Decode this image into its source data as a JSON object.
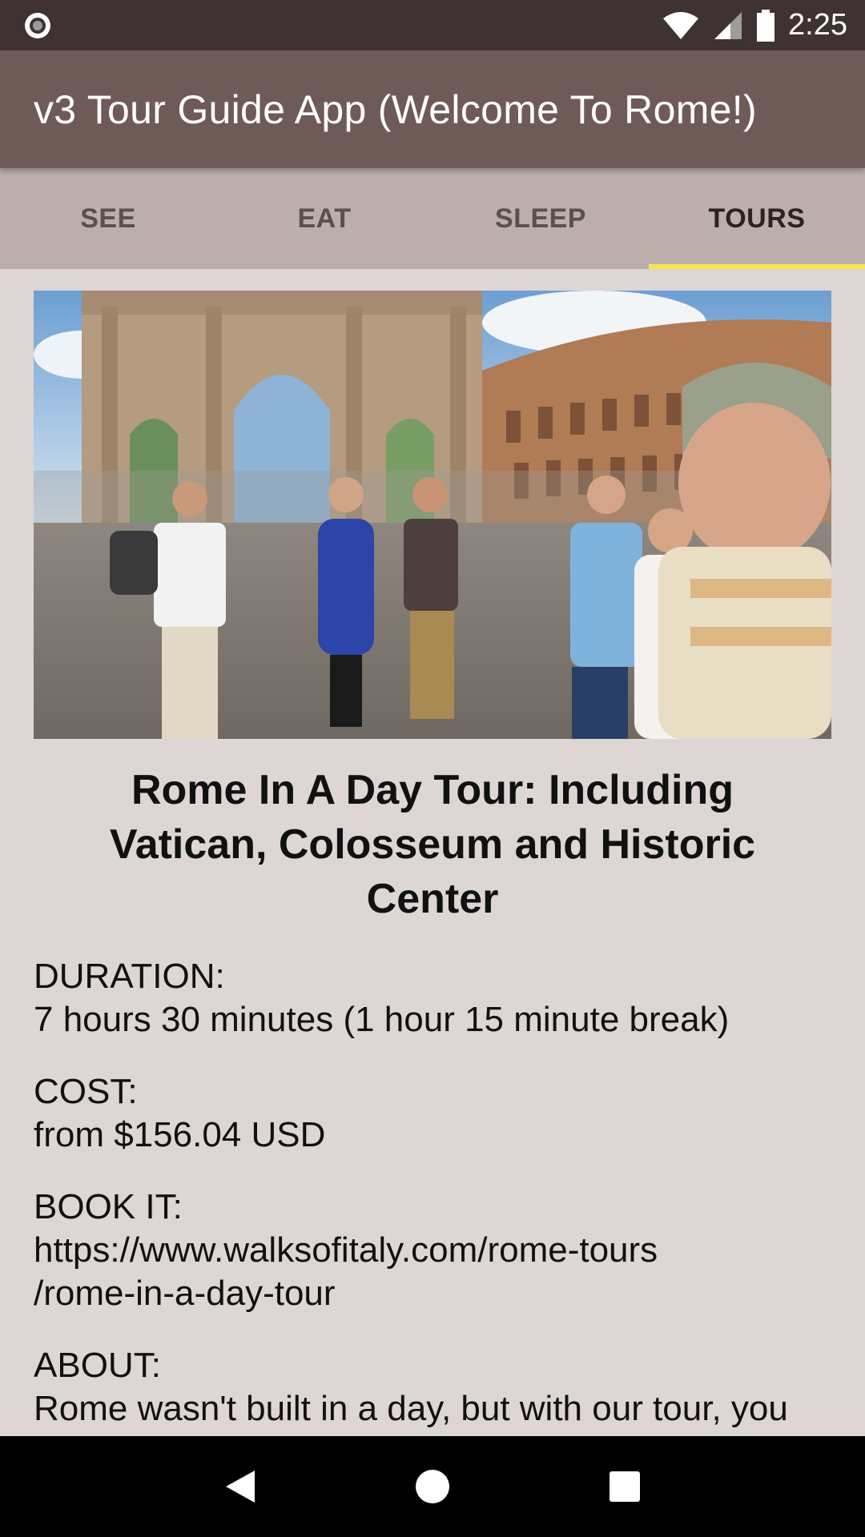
{
  "status_bar": {
    "time": "2:25",
    "icons": [
      "notification-circle-icon",
      "wifi-icon",
      "signal-icon",
      "battery-icon"
    ]
  },
  "app_bar": {
    "title": "v3 Tour Guide App (Welcome To Rome!)"
  },
  "tabs": [
    {
      "label": "SEE",
      "active": false
    },
    {
      "label": "EAT",
      "active": false
    },
    {
      "label": "SLEEP",
      "active": false
    },
    {
      "label": "TOURS",
      "active": true
    }
  ],
  "tour": {
    "title": "Rome In A Day Tour: Including Vatican, Colosseum and Historic Center",
    "duration_label": "DURATION:",
    "duration_value": "7 hours 30 minutes (1 hour 15 minute break)",
    "cost_label": "COST:",
    "cost_value": "from $156.04 USD",
    "book_label": "BOOK IT:",
    "book_value_line1": "https://www.walksofitaly.com/rome-tours",
    "book_value_line2": "/rome-in-a-day-tour",
    "about_label": "ABOUT:",
    "about_value": "Rome wasn't built in a day, but with our tour, you can see it in a day! You will see all the top"
  },
  "nav_bar": {
    "icons": [
      "back-icon",
      "home-icon",
      "recents-icon"
    ]
  },
  "colors": {
    "status_bar": "#3e3332",
    "app_bar": "#6e5b57",
    "tabs_bg": "#bcaeab",
    "tab_indicator": "#fbe64a",
    "content_bg": "#ddd6d4"
  }
}
